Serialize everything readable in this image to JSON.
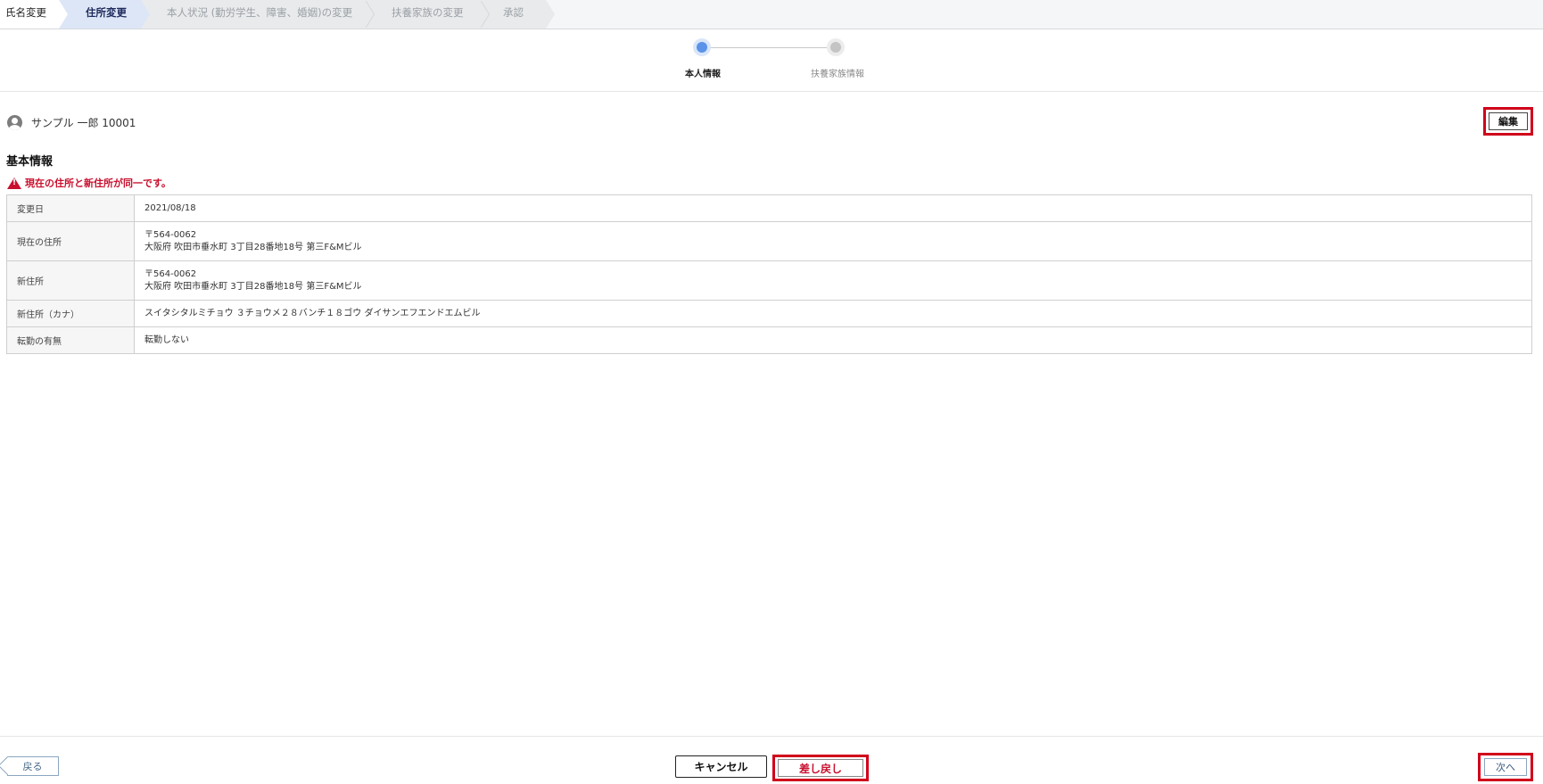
{
  "breadcrumbs": [
    {
      "label": "氏名変更",
      "state": "done"
    },
    {
      "label": "住所変更",
      "state": "active"
    },
    {
      "label": "本人状況 (勤労学生、障害、婚姻)の変更",
      "state": "pending"
    },
    {
      "label": "扶養家族の変更",
      "state": "pending"
    },
    {
      "label": "承認",
      "state": "pending"
    }
  ],
  "steps": [
    {
      "label": "本人情報",
      "state": "active"
    },
    {
      "label": "扶養家族情報",
      "state": "inactive"
    }
  ],
  "user": {
    "name": "サンプル 一郎 10001"
  },
  "edit_button": "編集",
  "section_title": "基本情報",
  "warning": "現在の住所と新住所が同一です。",
  "rows": [
    {
      "label": "変更日",
      "lines": [
        "2021/08/18"
      ]
    },
    {
      "label": "現在の住所",
      "lines": [
        "〒564-0062",
        "大阪府 吹田市垂水町 3丁目28番地18号 第三F&Mビル"
      ]
    },
    {
      "label": "新住所",
      "lines": [
        "〒564-0062",
        "大阪府 吹田市垂水町 3丁目28番地18号 第三F&Mビル"
      ]
    },
    {
      "label": "新住所（カナ）",
      "lines": [
        "スイタシタルミチョウ ３チョウメ２８バンチ１８ゴウ ダイサンエフエンドエムビル"
      ]
    },
    {
      "label": "転勤の有無",
      "lines": [
        "転勤しない"
      ]
    }
  ],
  "footer": {
    "back": "戻る",
    "cancel": "キャンセル",
    "return": "差し戻し",
    "next": "次へ"
  },
  "colors": {
    "highlight": "#d0021b",
    "warning": "#c8102e",
    "active_step": "#5a93e8",
    "active_crumb_bg": "#dde6f7"
  }
}
